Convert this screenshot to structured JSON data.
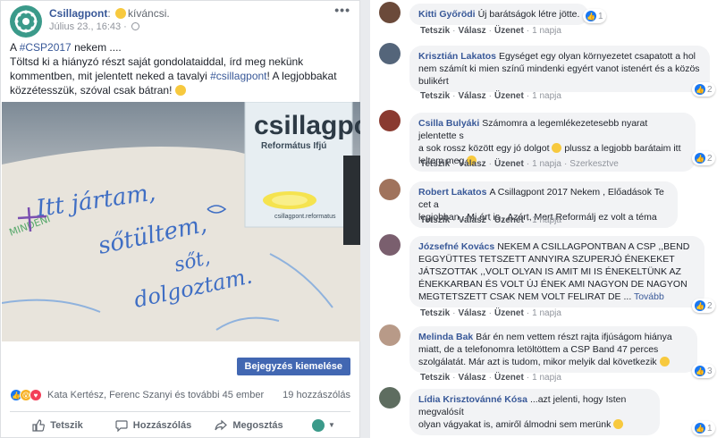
{
  "post": {
    "page_name": "Csillagpont",
    "feeling": "kíváncsi.",
    "date": "Július 23., 16:43",
    "more": "•••",
    "text_line1_pre": "A ",
    "text_hashtag1": "#CSP2017",
    "text_line1_post": " nekem ....",
    "text_body_pre": "Töltsd ki a hiányzó részt saját gondolataiddal, írd meg nekünk kommentben, mit jelentett neked a tavalyi ",
    "text_hashtag2": "#csillagpont",
    "text_body_post": "! A legjobbakat közzétesszük, szóval csak bátran! ",
    "boost_label": "Bejegyzés kiemelése",
    "reactors": "Kata Kertész, Ferenc Szanyi és további 45 ember",
    "comment_count": "19 hozzászólás",
    "actions": {
      "like": "Tetszik",
      "comment": "Hozzászólás",
      "share": "Megosztás"
    },
    "image": {
      "cup_brand": "csillagpont",
      "cup_sub": "Református Ifjú",
      "cup_small": "csillagpont.reformatus",
      "hand_text_1": "Itt jártam,",
      "hand_text_2": "sőtültem,",
      "hand_text_3": "sőt,",
      "hand_text_4": "dolgoztam.",
      "hand_text_5": "MINDENI"
    }
  },
  "comment_actions": {
    "like": "Tetszik",
    "reply": "Válasz",
    "message": "Üzenet",
    "edited": "Szerkesztve"
  },
  "comments": [
    {
      "name": "Kitti Győrödi",
      "text": "Új barátságok létre jötte.",
      "time": "1 napja",
      "reacts": "1"
    },
    {
      "name": "Krisztián Lakatos",
      "text_l1": "Egységet egy olyan környezetet csapatott a hol",
      "text_l2": "nem számít ki mien színű mindenki egyért vanot istenért és a közös",
      "text_l3": "bulikért",
      "time": "1 napja",
      "reacts": "2"
    },
    {
      "name": "Csilla Bulyáki",
      "text_l1": "Számomra a legemlékezetesebb nyarat jelentette s",
      "text_l2": "a sok rossz között egy jó dolgot",
      "text_l2b": " plussz a legjobb barátaim itt",
      "text_l3": "leltem meg",
      "time": "1 napja",
      "reacts": "2"
    },
    {
      "name": "Robert Lakatos",
      "text_l1": "A Csillagpont 2017 Nekem , Előadások Te cet a",
      "text_l2": "legjobban , Mi ért is , Azért, Mert Reformálj ez volt a téma",
      "time": "1 napja",
      "reacts": ""
    },
    {
      "name": "Józsefné Kovács",
      "text_l1": "NEKEM A CSILLAGPONTBAN A CSP ,,BEND",
      "text_l2": "EGGYÜTTES TETSZETT ANNYIRA SZUPERJÓ ÉNEKEKET",
      "text_l3": "JÁTSZOTTAK ,,VOLT OLYAN IS AMIT MI IS ÉNEKELTÜNK AZ",
      "text_l4": "ÉNEKKARBAN ÉS VOLT ÚJ ÉNEK AMI NAGYON DE NAGYON",
      "text_l5": "MEGTETSZETT CSAK NEM VOLT FELIRAT DE ...",
      "more": "Tovább",
      "time": "1 napja",
      "reacts": "2"
    },
    {
      "name": "Melinda Bak",
      "text_l1": "Bár én nem vettem részt rajta ifjúságom hiánya",
      "text_l2": "miatt, de a telefonomra letöltöttem a CSP Band 47 perces",
      "text_l3": "szolgálatát. Már azt is tudom, mikor melyik dal következik",
      "time": "1 napja",
      "reacts": "3"
    },
    {
      "name": "Lídia Krisztovánné Kósa",
      "text_l1": "...azt jelenti, hogy Isten megvalósít",
      "text_l2": "olyan vágyakat is, amiről álmodni sem merünk",
      "time": "1 napja",
      "reacts": "1"
    }
  ]
}
